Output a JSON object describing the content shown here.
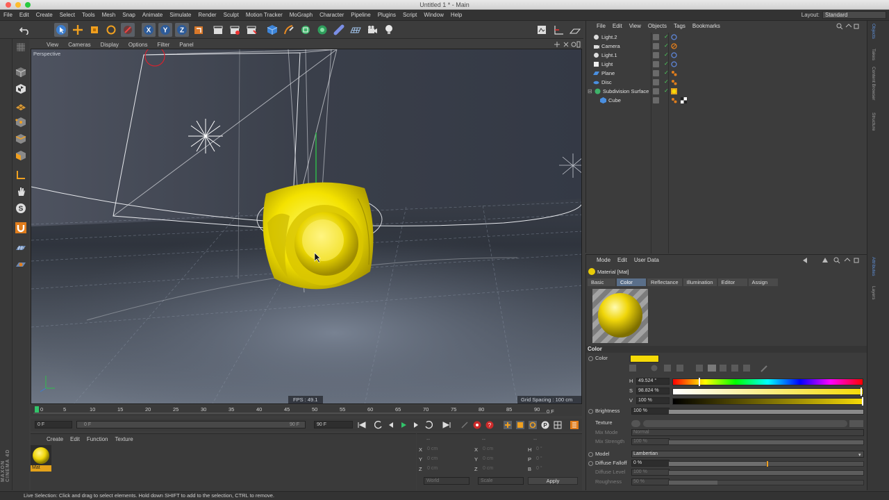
{
  "window": {
    "title": "Untitled 1 * - Main"
  },
  "menubar": {
    "items": [
      "File",
      "Edit",
      "Create",
      "Select",
      "Tools",
      "Mesh",
      "Snap",
      "Animate",
      "Simulate",
      "Render",
      "Sculpt",
      "Motion Tracker",
      "MoGraph",
      "Character",
      "Pipeline",
      "Plugins",
      "Script",
      "Window",
      "Help"
    ],
    "layout_label": "Layout:",
    "layout_value": "Standard"
  },
  "viewport": {
    "menu": [
      "View",
      "Cameras",
      "Display",
      "Options",
      "Filter",
      "Panel"
    ],
    "name": "Perspective",
    "fps": "FPS : 49.1",
    "grid_spacing": "Grid Spacing : 100 cm"
  },
  "timeline": {
    "ticks": [
      "0",
      "5",
      "10",
      "15",
      "20",
      "25",
      "30",
      "35",
      "40",
      "45",
      "50",
      "55",
      "60",
      "65",
      "70",
      "75",
      "80",
      "85",
      "90"
    ],
    "current_frame_readout": "0 F",
    "start_frame": "0 F",
    "range_start": "0 F",
    "range_end": "90 F",
    "end_frame": "90 F"
  },
  "material_manager": {
    "menu": [
      "Create",
      "Edit",
      "Function",
      "Texture"
    ],
    "materials": [
      {
        "name": "Mat",
        "color": "#f0d60a"
      }
    ]
  },
  "coordinates": {
    "header": [
      "--",
      "--",
      "--"
    ],
    "rows": [
      {
        "a": "X",
        "a_val": "0 cm",
        "b": "X",
        "b_val": "0 cm",
        "c": "H",
        "c_val": "0 °"
      },
      {
        "a": "Y",
        "a_val": "0 cm",
        "b": "Y",
        "b_val": "0 cm",
        "c": "P",
        "c_val": "0 °"
      },
      {
        "a": "Z",
        "a_val": "0 cm",
        "b": "Z",
        "b_val": "0 cm",
        "c": "B",
        "c_val": "0 °"
      }
    ],
    "mode": "World",
    "scale": "Scale",
    "apply_label": "Apply"
  },
  "object_manager": {
    "menu": [
      "File",
      "Edit",
      "View",
      "Objects",
      "Tags",
      "Bookmarks"
    ],
    "objects": [
      {
        "name": "Light.2",
        "icon": "light-icon",
        "tag": "target-tag-icon"
      },
      {
        "name": "Camera",
        "icon": "camera-icon",
        "tag": "camera-tag-icon"
      },
      {
        "name": "Light.1",
        "icon": "light-icon",
        "tag": "target-tag-icon"
      },
      {
        "name": "Light",
        "icon": "light-icon",
        "tag": "target-tag-icon"
      },
      {
        "name": "Plane",
        "icon": "plane-icon",
        "tag": "phong-tag-icon"
      },
      {
        "name": "Disc",
        "icon": "disc-icon",
        "tag": "phong-tag-icon"
      },
      {
        "name": "Subdivision Surface",
        "icon": "subdivision-icon",
        "tag": "material-tag-icon"
      },
      {
        "name": "Cube",
        "icon": "cube-icon",
        "tag": "phong-checker-tag-icon"
      }
    ]
  },
  "attribute_manager": {
    "menu": [
      "Mode",
      "Edit",
      "User Data"
    ],
    "title": "Material [Mat]",
    "tabs": [
      "Basic",
      "Color",
      "Reflectance",
      "Illumination",
      "Editor",
      "Assign"
    ],
    "active_tab": "Color",
    "section_color": "Color",
    "color_label": "Color",
    "color_swatch": "#f5da07",
    "h_label": "H",
    "h_value": "49.524 °",
    "s_label": "S",
    "s_value": "98.824 %",
    "v_label": "V",
    "v_value": "100 %",
    "brightness_label": "Brightness",
    "brightness_value": "100 %",
    "texture_label": "Texture",
    "mix_mode_label": "Mix Mode",
    "mix_mode_value": "Normal",
    "mix_strength_label": "Mix Strength",
    "mix_strength_value": "100 %",
    "model_label": "Model",
    "model_value": "Lambertian",
    "diffuse_falloff_label": "Diffuse Falloff",
    "diffuse_falloff_value": "0 %",
    "diffuse_level_label": "Diffuse Level",
    "diffuse_level_value": "100 %",
    "roughness_label": "Roughness",
    "roughness_value": "50 %"
  },
  "right_tabs": [
    "Objects",
    "Takes",
    "Content Browser",
    "Structure",
    "Attributes",
    "Layers"
  ],
  "brand": "MAXON CINEMA 4D",
  "status": "Live Selection: Click and drag to select elements. Hold down SHIFT to add to the selection, CTRL to remove."
}
